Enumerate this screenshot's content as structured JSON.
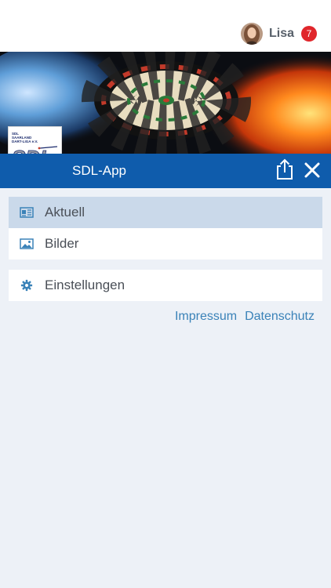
{
  "header": {
    "user_name": "Lisa",
    "notification_count": "7"
  },
  "logo": {
    "line1": "SDL",
    "line2": "SAARLAND",
    "line3": "DART-LIGA e.V.",
    "mark": "SDL"
  },
  "app_bar": {
    "title": "SDL-App",
    "accent_color": "#0f5cac"
  },
  "menu": {
    "items": [
      {
        "label": "Aktuell",
        "icon": "news-icon",
        "active": true
      },
      {
        "label": "Bilder",
        "icon": "image-icon",
        "active": false
      }
    ],
    "settings": {
      "label": "Einstellungen",
      "icon": "gear-icon"
    }
  },
  "footer_links": {
    "impressum": "Impressum",
    "datenschutz": "Datenschutz"
  }
}
